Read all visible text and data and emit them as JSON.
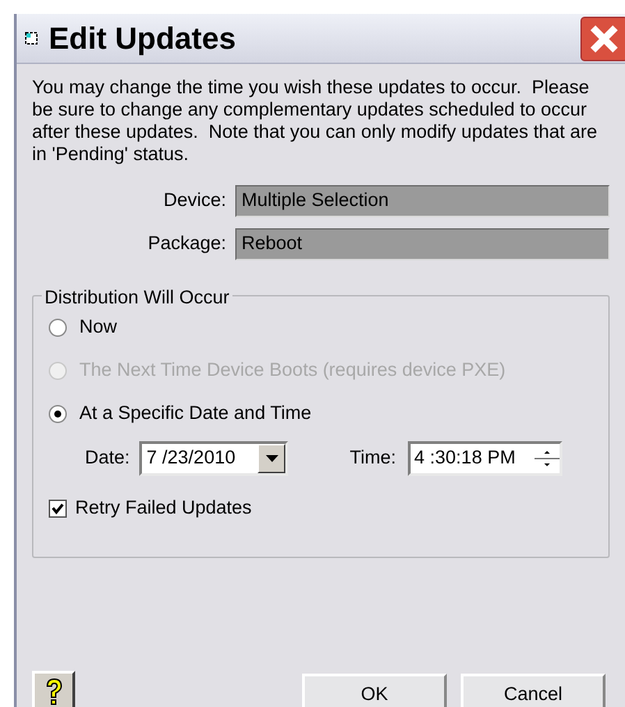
{
  "window": {
    "title": "Edit Updates"
  },
  "intro": "You may change the time you wish these updates to occur.  Please be sure to change any complementary updates scheduled to occur after these updates.  Note that you can only modify updates that are in 'Pending' status.",
  "fields": [
    {
      "label": "Device:",
      "value": "Multiple Selection"
    },
    {
      "label": "Package:",
      "value": "Reboot"
    }
  ],
  "distribution": {
    "title": "Distribution Will Occur",
    "options": [
      {
        "label": "Now",
        "selected": false,
        "disabled": false
      },
      {
        "label": "The Next Time Device Boots (requires device PXE)",
        "selected": false,
        "disabled": true
      },
      {
        "label": "At a Specific Date and Time",
        "selected": true,
        "disabled": false
      }
    ],
    "date": {
      "label": "Date:",
      "value": "7 /23/2010"
    },
    "time": {
      "label": "Time:",
      "value": "4 :30:18 PM"
    },
    "retry": {
      "label": "Retry Failed Updates",
      "checked": true
    }
  },
  "buttons": [
    {
      "label": "OK"
    },
    {
      "label": "Cancel"
    }
  ]
}
